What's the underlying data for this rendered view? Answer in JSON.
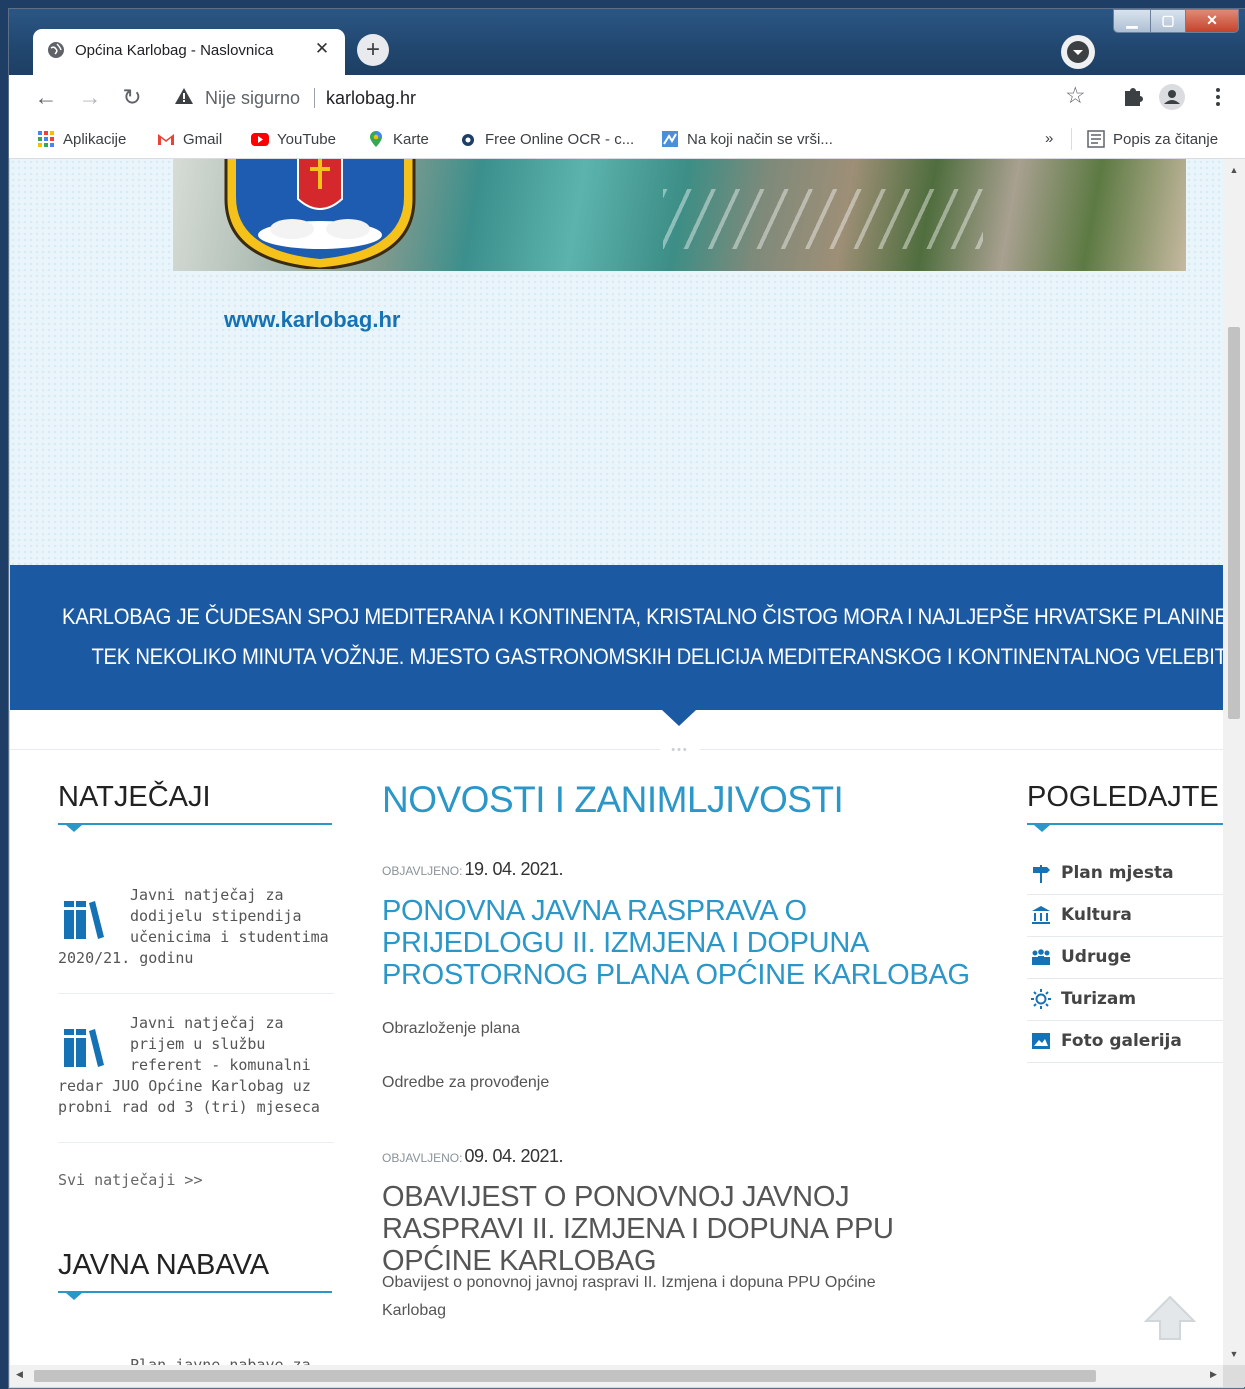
{
  "browser": {
    "tab_title": "Općina Karlobag - Naslovnica",
    "tab_close": "✕",
    "new_tab": "+",
    "security_text": "Nije sigurno",
    "url": "karlobag.hr",
    "bookmarks": [
      {
        "label": "Aplikacije",
        "icon": "apps-grid-icon"
      },
      {
        "label": "Gmail",
        "icon": "gmail-icon"
      },
      {
        "label": "YouTube",
        "icon": "youtube-icon"
      },
      {
        "label": "Karte",
        "icon": "maps-pin-icon"
      },
      {
        "label": "Free Online OCR - c...",
        "icon": "ocr-icon"
      },
      {
        "label": "Na koji način se vrši...",
        "icon": "bookmark-page-icon"
      }
    ],
    "bookmarks_overflow": "»",
    "reading_list": "Popis za čitanje"
  },
  "site": {
    "url_text": "www.karlobag.hr",
    "slogan_lines": [
      "KARLOBAG JE ČUDESAN SPOJ MEDITERANA I KONTINENTA, KRISTALNO ČISTOG MORA I NAJLJEPŠE HRVATSKE PLANINE DO K",
      "TEK NEKOLIKO MINUTA VOŽNJE. MJESTO GASTRONOMSKIH DELICIJA MEDITERANSKOG I KONTINENTALNOG VELEBITSKOG S"
    ],
    "divider_dots": "•••"
  },
  "natjecaji": {
    "heading": "NATJEČAJI",
    "items": [
      {
        "text": "Javni natječaj za dodijelu stipendija učenicima i studentima 2020/21. godinu"
      },
      {
        "text": "Javni natječaj za prijem u službu referent - komunalni redar JUO Općine Karlobag uz probni rad od 3 (tri) mjeseca"
      }
    ],
    "all_link": "Svi natječaji >>"
  },
  "javna_nabava": {
    "heading": "JAVNA NABAVA",
    "first_item": "Plan javne nabave za"
  },
  "news": {
    "heading": "NOVOSTI I ZANIMLJIVOSTI",
    "published_label": "OBJAVLJENO:",
    "articles": [
      {
        "date": "19. 04. 2021.",
        "title": "PONOVNA JAVNA RASPRAVA O PRIJEDLOGU II. IZMJENA I DOPUNA PROSTORNOG PLANA OPĆINE KARLOBAG",
        "links": [
          "Obrazloženje plana",
          "Odredbe za provođenje"
        ]
      },
      {
        "date": "09. 04. 2021.",
        "title": "OBAVIJEST O PONOVNOJ JAVNOJ RASPRAVI II. IZMJENA I DOPUNA PPU OPĆINE KARLOBAG",
        "links": [
          "Obavijest o ponovnoj javnoj raspravi II. Izmjena i dopuna PPU Općine Karlobag"
        ]
      }
    ]
  },
  "pogledajte": {
    "heading": "POGLEDAJTE",
    "items": [
      {
        "label": "Plan mjesta",
        "icon": "signpost-icon"
      },
      {
        "label": "Kultura",
        "icon": "museum-icon"
      },
      {
        "label": "Udruge",
        "icon": "people-icon"
      },
      {
        "label": "Turizam",
        "icon": "sun-icon"
      },
      {
        "label": "Foto galerija",
        "icon": "photo-icon"
      }
    ]
  },
  "colors": {
    "accent": "#2a97c8",
    "band": "#1b5aa2"
  }
}
